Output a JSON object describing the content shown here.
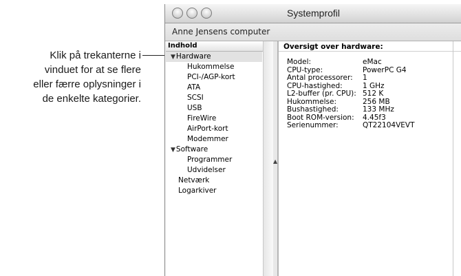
{
  "callout": {
    "lines": [
      "Klik på trekanterne i",
      "vinduet for at se flere",
      "eller færre oplysninger i",
      "de enkelte kategorier."
    ]
  },
  "window": {
    "title": "Systemprofil",
    "computer_name": "Anne Jensens computer",
    "contents_header": "Indhold",
    "tree": [
      {
        "label": "Hardware",
        "expanded": true,
        "level": 0,
        "selected": true
      },
      {
        "label": "Hukommelse",
        "level": 1
      },
      {
        "label": "PCI-/AGP-kort",
        "level": 1
      },
      {
        "label": "ATA",
        "level": 1
      },
      {
        "label": "SCSI",
        "level": 1
      },
      {
        "label": "USB",
        "level": 1
      },
      {
        "label": "FireWire",
        "level": 1
      },
      {
        "label": "AirPort-kort",
        "level": 1
      },
      {
        "label": "Modemmer",
        "level": 1
      },
      {
        "label": "Software",
        "expanded": true,
        "level": 0
      },
      {
        "label": "Programmer",
        "level": 1
      },
      {
        "label": "Udvidelser",
        "level": 1
      },
      {
        "label": "Netværk",
        "level": 0
      },
      {
        "label": "Logarkiver",
        "level": 0
      }
    ],
    "detail_title": "Oversigt over hardware:",
    "details": [
      {
        "label": "Model:",
        "value": "eMac"
      },
      {
        "label": "CPU-type:",
        "value": "PowerPC G4"
      },
      {
        "label": "Antal processorer:",
        "value": "1"
      },
      {
        "label": "CPU-hastighed:",
        "value": "1 GHz"
      },
      {
        "label": "L2-buffer (pr. CPU):",
        "value": "512 K"
      },
      {
        "label": "Hukommelse:",
        "value": "256 MB"
      },
      {
        "label": "Bushastighed:",
        "value": "133 MHz"
      },
      {
        "label": "Boot ROM-version:",
        "value": "4.45f3"
      },
      {
        "label": "Serienummer:",
        "value": "QT22104VEVT"
      }
    ]
  }
}
